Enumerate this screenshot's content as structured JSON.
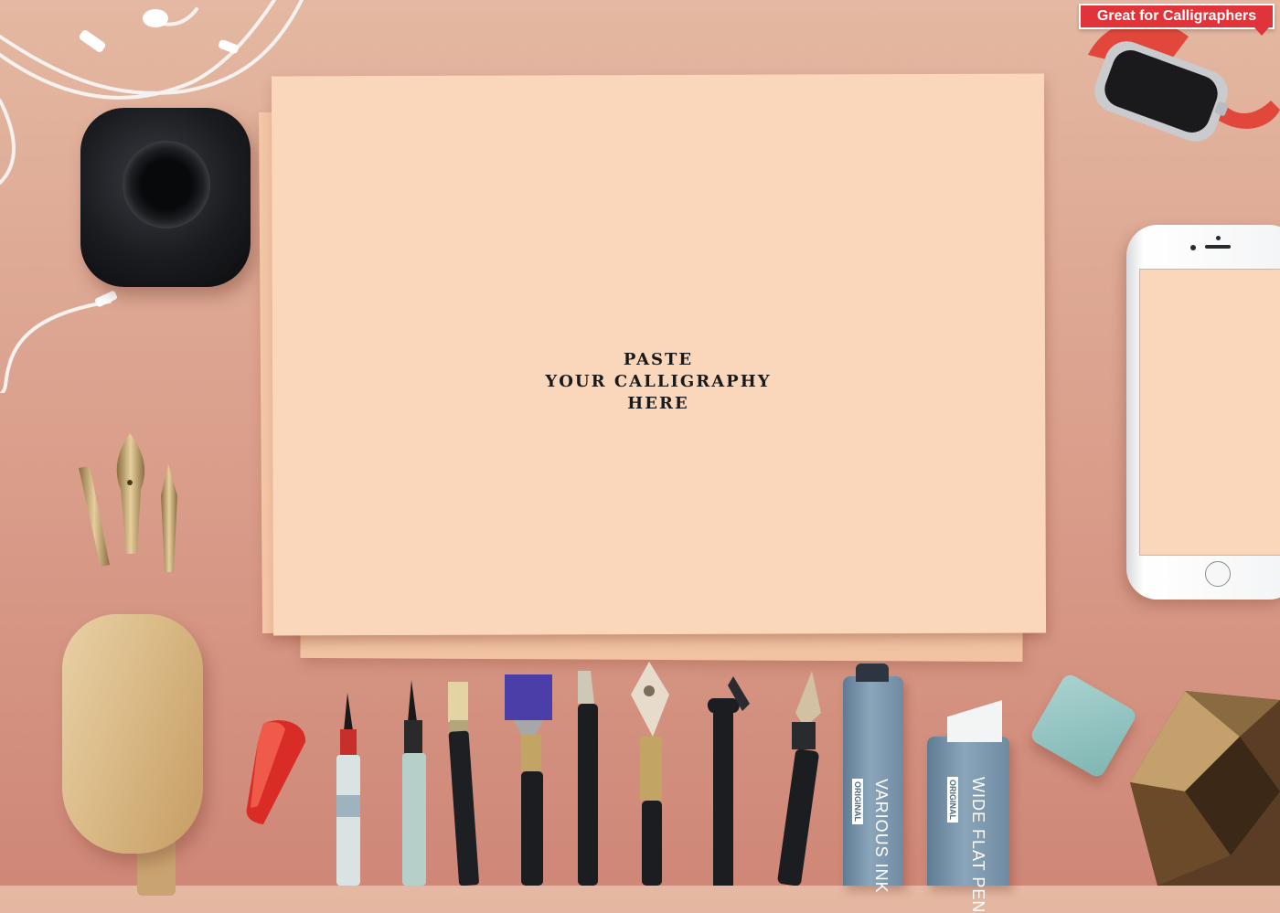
{
  "badge": {
    "label": "Great for Calligraphers"
  },
  "paper": {
    "line1": "PASTE",
    "line2": "YOUR CALLIGRAPHY",
    "line3": "HERE"
  },
  "markers": {
    "various": {
      "brand": "VARIOUS INK",
      "tag": "ORIGINAL"
    },
    "wide": {
      "brand": "WIDE FLAT PEN",
      "tag": "ORIGINAL"
    }
  },
  "colors": {
    "background_top": "#e4b8a2",
    "background_bottom": "#cf8777",
    "paper": "#fad6ba",
    "badge": "#e0343a",
    "watch_band": "#e2473b",
    "marker_blue": "#6f8aa1"
  },
  "icons": [
    "earphones-icon",
    "ink-bottle-icon",
    "pen-nib-icon",
    "watch-icon",
    "phone-icon",
    "popsicle-icon",
    "marker-icon",
    "gem-icon"
  ]
}
